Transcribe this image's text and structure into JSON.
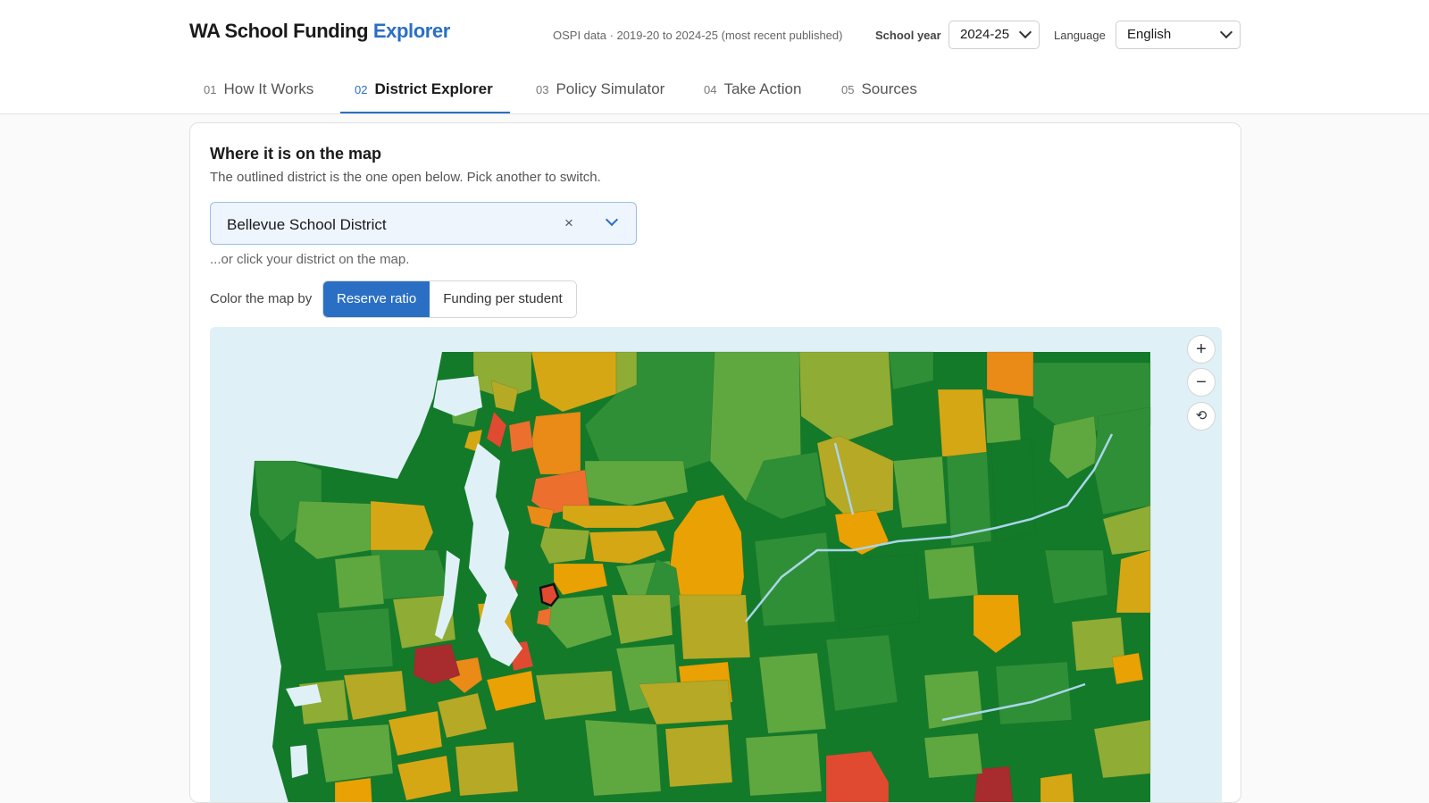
{
  "header": {
    "title_main": "WA School Funding",
    "title_accent": "Explorer",
    "meta": "OSPI data · 2019-20 to 2024-25 (most recent published)",
    "school_year_label": "School year",
    "school_year_value": "2024-25",
    "language_label": "Language",
    "language_value": "English"
  },
  "tabs": [
    {
      "num": "01",
      "label": "How It Works"
    },
    {
      "num": "02",
      "label": "District Explorer"
    },
    {
      "num": "03",
      "label": "Policy Simulator"
    },
    {
      "num": "04",
      "label": "Take Action"
    },
    {
      "num": "05",
      "label": "Sources"
    }
  ],
  "card": {
    "title": "Where it is on the map",
    "subtitle": "The outlined district is the one open below. Pick another to switch.",
    "district_value": "Bellevue School District",
    "clear_symbol": "×",
    "hint": "...or click your district on the map.",
    "color_label": "Color the map by",
    "color_options": [
      "Reserve ratio",
      "Funding per student"
    ],
    "color_selected": "Reserve ratio"
  },
  "map": {
    "zoom_in": "+",
    "zoom_out": "−",
    "reset": "⟲",
    "selected_district": "Bellevue School District",
    "palette": {
      "dark_red": "#a82b2e",
      "red": "#e04a30",
      "orange_red": "#ec6f2e",
      "orange": "#ea8a17",
      "amber": "#e9a104",
      "mustard": "#d6a714",
      "olive": "#b5a925",
      "yellow_green": "#8fac34",
      "light_green": "#5ea83f",
      "green": "#2f8f36",
      "dark_green": "#137a2a",
      "water": "#dff1f6"
    }
  }
}
